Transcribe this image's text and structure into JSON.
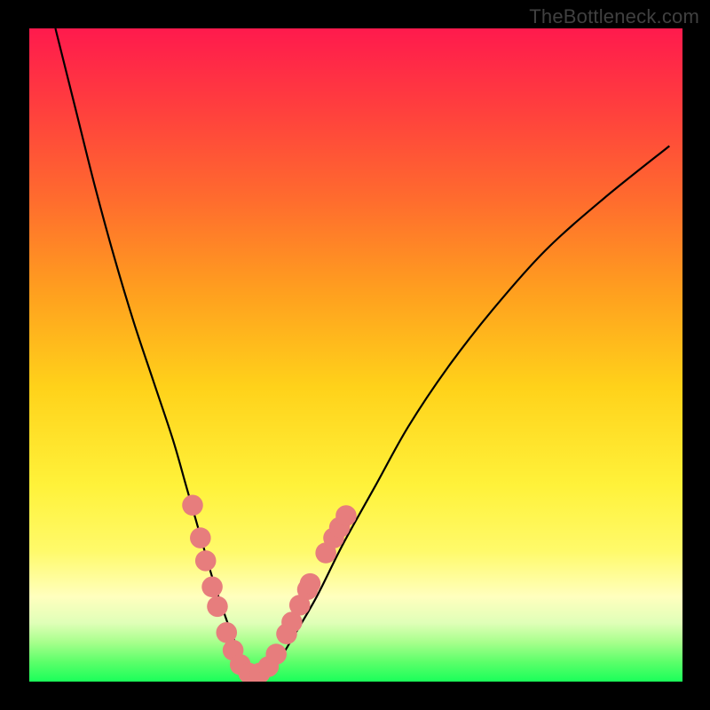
{
  "watermark": "TheBottleneck.com",
  "chart_data": {
    "type": "line",
    "title": "",
    "xlabel": "",
    "ylabel": "",
    "xlim": [
      0,
      100
    ],
    "ylim": [
      0,
      100
    ],
    "curve_main": {
      "name": "bottleneck-curve",
      "x": [
        4,
        7,
        10,
        13,
        16,
        19,
        22,
        24,
        26,
        28,
        30,
        31.5,
        33,
        34.5,
        36,
        38,
        40.5,
        44,
        48,
        53,
        58,
        64,
        71,
        79,
        88,
        98
      ],
      "y": [
        100,
        88,
        76,
        65,
        55,
        46,
        37,
        30,
        23,
        16,
        10,
        6,
        3,
        1.5,
        1.5,
        3,
        7,
        13,
        21,
        30,
        39,
        48,
        57,
        66,
        74,
        82
      ]
    },
    "markers": {
      "name": "highlight-dots",
      "color": "#e77d7d",
      "radius_pct": 1.6,
      "points": [
        {
          "x": 25.0,
          "y": 27
        },
        {
          "x": 26.2,
          "y": 22
        },
        {
          "x": 27.0,
          "y": 18.5
        },
        {
          "x": 28.0,
          "y": 14.5
        },
        {
          "x": 28.8,
          "y": 11.5
        },
        {
          "x": 30.2,
          "y": 7.5
        },
        {
          "x": 31.2,
          "y": 4.8
        },
        {
          "x": 32.3,
          "y": 2.6
        },
        {
          "x": 33.6,
          "y": 1.3
        },
        {
          "x": 35.3,
          "y": 1.3
        },
        {
          "x": 36.6,
          "y": 2.3
        },
        {
          "x": 37.8,
          "y": 4.2
        },
        {
          "x": 39.4,
          "y": 7.3
        },
        {
          "x": 40.2,
          "y": 9.1
        },
        {
          "x": 41.4,
          "y": 11.7
        },
        {
          "x": 42.6,
          "y": 14.1
        },
        {
          "x": 43.0,
          "y": 15.0
        },
        {
          "x": 45.4,
          "y": 19.7
        },
        {
          "x": 46.6,
          "y": 22.0
        },
        {
          "x": 47.5,
          "y": 23.6
        },
        {
          "x": 48.5,
          "y": 25.4
        }
      ]
    }
  }
}
